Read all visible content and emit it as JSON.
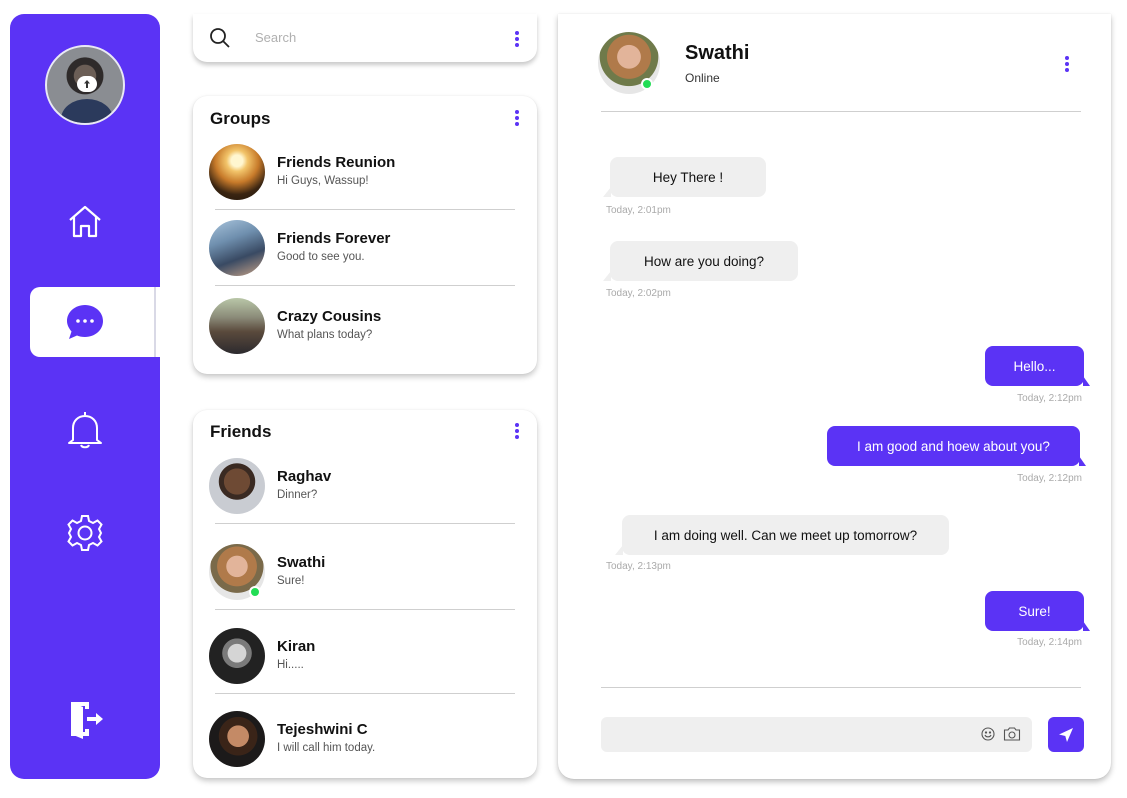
{
  "colors": {
    "accent": "#5b33f5",
    "bubble_in": "#efefef",
    "online": "#22dd55"
  },
  "sidebar": {
    "profile_icon": "user-avatar",
    "items": [
      {
        "icon": "home-icon",
        "active": false
      },
      {
        "icon": "chat-icon",
        "active": true
      },
      {
        "icon": "bell-icon",
        "active": false
      },
      {
        "icon": "gear-icon",
        "active": false
      }
    ],
    "logout_icon": "logout-icon"
  },
  "search": {
    "placeholder": "Search",
    "value": ""
  },
  "groups": {
    "title": "Groups",
    "items": [
      {
        "name": "Friends Reunion",
        "message": "Hi Guys, Wassup!"
      },
      {
        "name": "Friends Forever",
        "message": "Good to see you."
      },
      {
        "name": "Crazy Cousins",
        "message": "What plans today?"
      }
    ]
  },
  "friends": {
    "title": "Friends",
    "items": [
      {
        "name": "Raghav",
        "message": "Dinner?",
        "online": false
      },
      {
        "name": "Swathi",
        "message": "Sure!",
        "online": true
      },
      {
        "name": "Kiran",
        "message": "Hi.....",
        "online": false
      },
      {
        "name": "Tejeshwini C",
        "message": "I will call him today.",
        "online": false
      }
    ]
  },
  "chat": {
    "contact_name": "Swathi",
    "contact_status": "Online",
    "messages": [
      {
        "direction": "in",
        "text": "Hey There !",
        "time": "Today, 2:01pm"
      },
      {
        "direction": "in",
        "text": "How are you doing?",
        "time": "Today, 2:02pm"
      },
      {
        "direction": "out",
        "text": "Hello...",
        "time": "Today, 2:12pm"
      },
      {
        "direction": "out",
        "text": "I am good  and hoew about you?",
        "time": "Today, 2:12pm"
      },
      {
        "direction": "in",
        "text": "I am doing well. Can we meet up tomorrow?",
        "time": "Today, 2:13pm"
      },
      {
        "direction": "out",
        "text": "Sure!",
        "time": "Today, 2:14pm"
      }
    ],
    "compose": {
      "placeholder": "",
      "value": ""
    }
  }
}
